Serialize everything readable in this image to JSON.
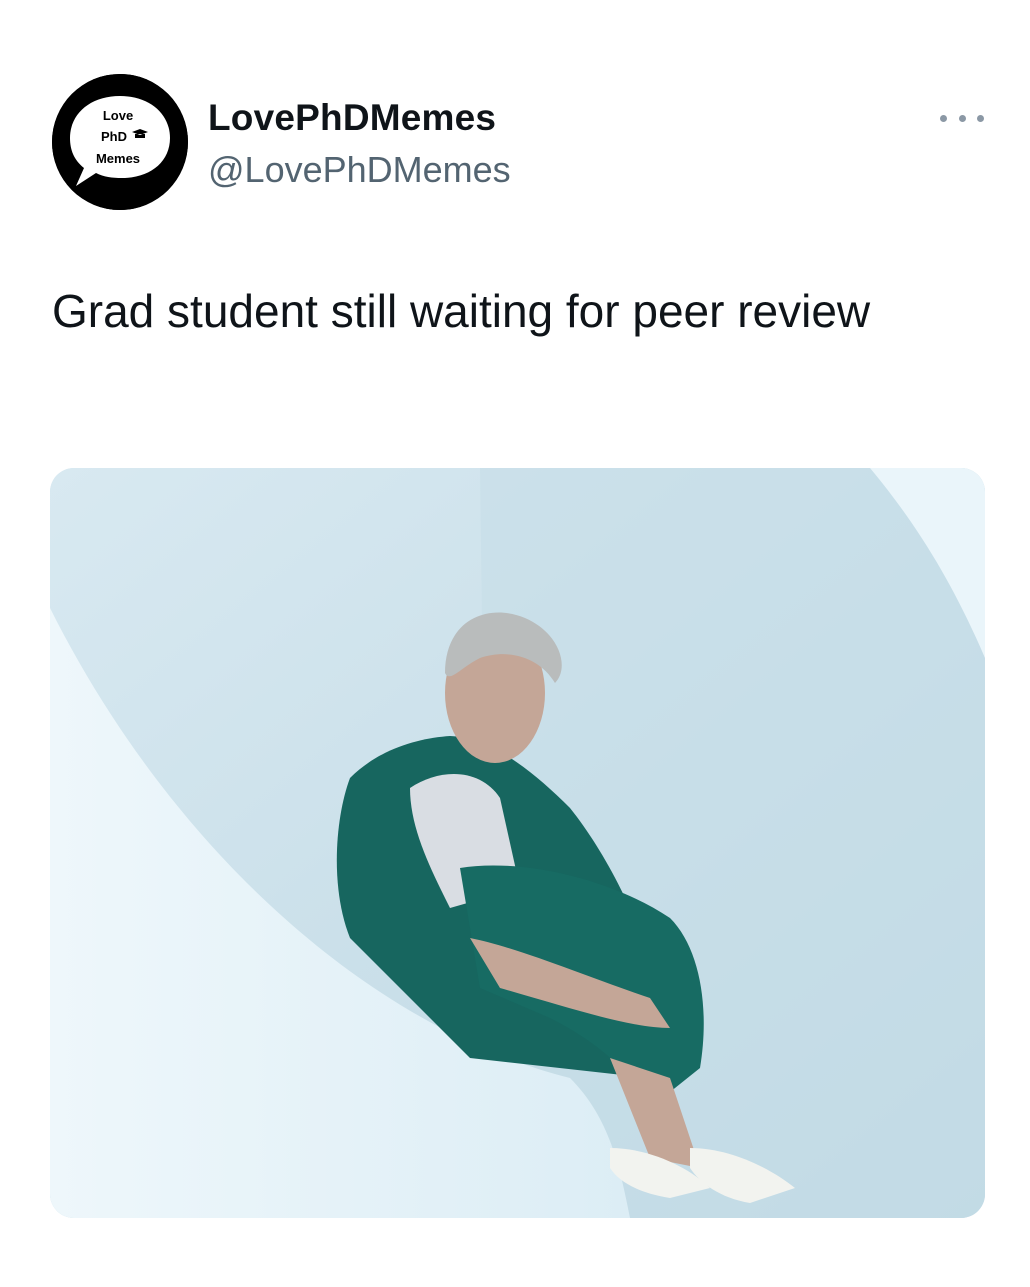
{
  "author": {
    "avatar": {
      "icon": "speech-bubble-logo-icon",
      "lines": [
        "Love",
        "PhD",
        "Memes"
      ],
      "background": "#000000",
      "bubble_color": "#ffffff"
    },
    "display_name": "LovePhDMemes",
    "handle": "@LovePhDMemes"
  },
  "menu": {
    "icon": "more-options-icon"
  },
  "tweet": {
    "text": "Grad student still waiting for peer review"
  },
  "media": {
    "palette": {
      "wall": "#cfe5ef",
      "curve": "#e4f1f7",
      "uniform": "#17665f",
      "hair": "#b9bcbc",
      "skin": "#c4a697"
    }
  },
  "colors": {
    "text_primary": "#0f1419",
    "text_secondary": "#536471"
  }
}
